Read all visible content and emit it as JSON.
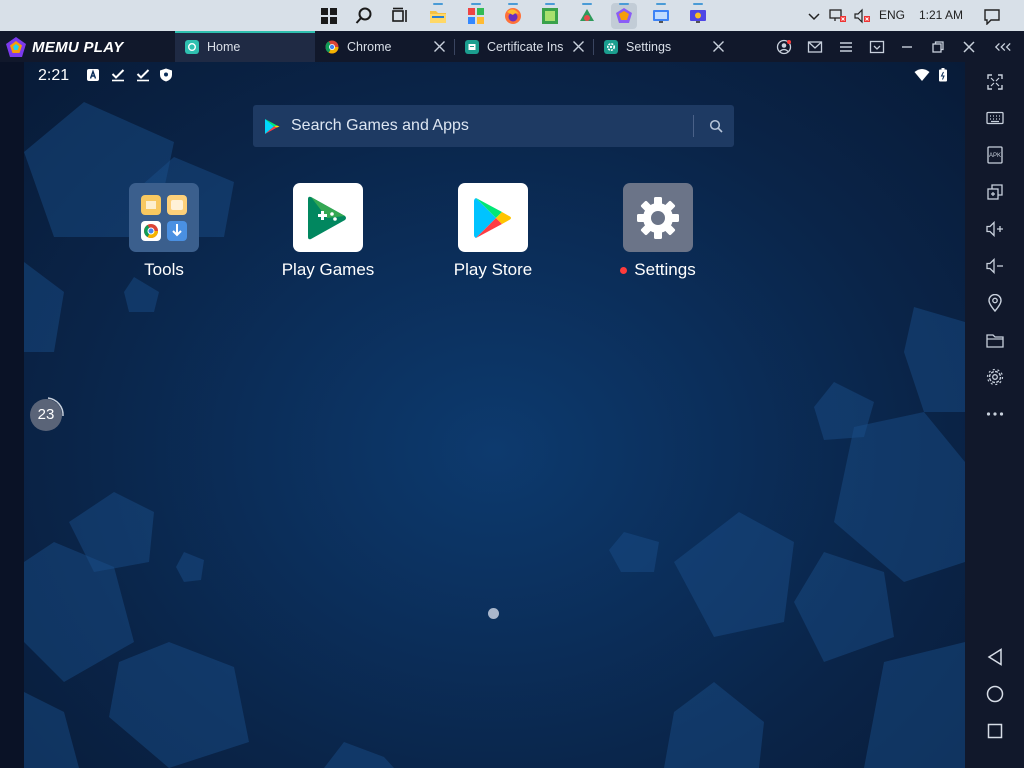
{
  "taskbar": {
    "icons": [
      "windows-start-icon",
      "search-icon",
      "task-view-icon",
      "file-explorer-icon",
      "app-icon-1",
      "firefox-icon",
      "app-icon-2",
      "app-icon-3",
      "memu-icon",
      "app-icon-4",
      "app-icon-5"
    ],
    "tray": {
      "language": "ENG",
      "time": "1:21 AM"
    }
  },
  "titlebar": {
    "brand": "MEMU PLAY",
    "tabs": [
      {
        "label": "Home",
        "icon": "home-icon",
        "active": true
      },
      {
        "label": "Chrome",
        "icon": "chrome-icon",
        "active": false
      },
      {
        "label": "Certificate Ins",
        "icon": "certificate-installer-icon",
        "active": false
      },
      {
        "label": "Settings",
        "icon": "settings-icon",
        "active": false
      }
    ]
  },
  "android": {
    "status": {
      "time": "2:21"
    },
    "search": {
      "placeholder": "Search Games and Apps"
    },
    "apps": [
      {
        "label": "Tools",
        "icon": "tools-folder-icon",
        "badge": false
      },
      {
        "label": "Play Games",
        "icon": "play-games-icon",
        "badge": false
      },
      {
        "label": "Play Store",
        "icon": "play-store-icon",
        "badge": false
      },
      {
        "label": "Settings",
        "icon": "settings-gear-icon",
        "badge": true
      }
    ],
    "fps": {
      "value": "23"
    }
  },
  "sidebar": {
    "buttons": [
      "fullscreen-icon",
      "keyboard-icon",
      "apk-install-icon",
      "multi-window-icon",
      "volume-up-icon",
      "volume-down-icon",
      "location-icon",
      "folder-icon",
      "gear-icon",
      "more-icon",
      "back-icon",
      "home-circle-icon",
      "recents-square-icon"
    ]
  },
  "colors": {
    "accent": "#2fc0b0",
    "badge": "#ff3b3b",
    "background": "#0b2e5a"
  }
}
